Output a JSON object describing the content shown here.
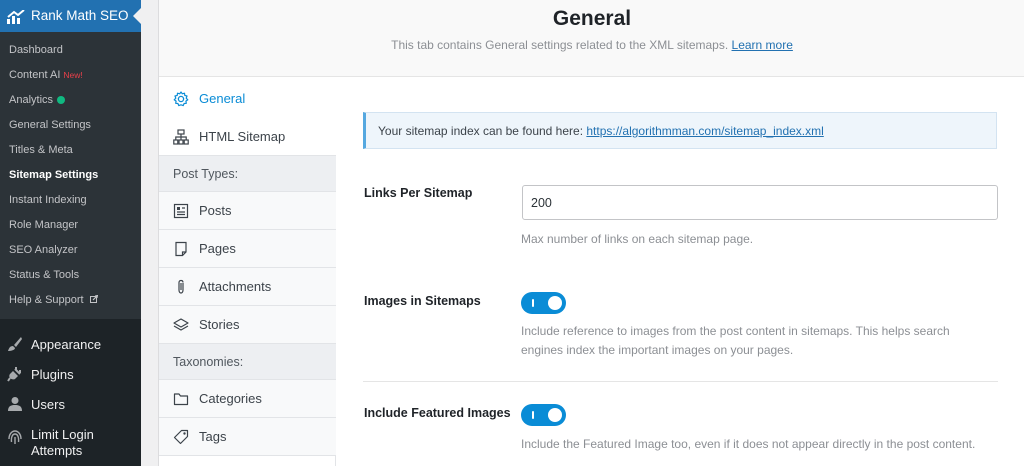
{
  "sidebar": {
    "plugin_title": "Rank Math SEO",
    "submenu": [
      {
        "label": "Dashboard"
      },
      {
        "label": "Content AI",
        "badge": "New!"
      },
      {
        "label": "Analytics",
        "status_color": "#10b981"
      },
      {
        "label": "General Settings"
      },
      {
        "label": "Titles & Meta"
      },
      {
        "label": "Sitemap Settings",
        "current": true
      },
      {
        "label": "Instant Indexing"
      },
      {
        "label": "Role Manager"
      },
      {
        "label": "SEO Analyzer"
      },
      {
        "label": "Status & Tools"
      },
      {
        "label": "Help & Support",
        "icon": "external-link-icon"
      }
    ],
    "main_menu": [
      {
        "label": "Appearance",
        "icon": "paintbrush-icon"
      },
      {
        "label": "Plugins",
        "icon": "plug-icon"
      },
      {
        "label": "Users",
        "icon": "user-icon"
      },
      {
        "label": "Limit Login Attempts",
        "label_line1": "Limit Login",
        "label_line2": "Attempts",
        "icon": "fingerprint-icon"
      }
    ]
  },
  "header": {
    "title": "General",
    "description": "This tab contains General settings related to the XML sitemaps.",
    "learn_more": "Learn more"
  },
  "tabs": {
    "general": {
      "label": "General",
      "icon": "gear-icon",
      "active": true
    },
    "html_sitemap": {
      "label": "HTML Sitemap",
      "icon": "sitemap-icon"
    },
    "post_types_heading": "Post Types:",
    "posts": {
      "label": "Posts",
      "icon": "posts-icon"
    },
    "pages": {
      "label": "Pages",
      "icon": "pages-icon"
    },
    "attachments": {
      "label": "Attachments",
      "icon": "paperclip-icon"
    },
    "stories": {
      "label": "Stories",
      "icon": "stories-icon"
    },
    "taxonomies_heading": "Taxonomies:",
    "categories": {
      "label": "Categories",
      "icon": "folder-icon"
    },
    "tags": {
      "label": "Tags",
      "icon": "tag-icon"
    }
  },
  "settings": {
    "notice_text": "Your sitemap index can be found here:",
    "notice_link": "https://algorithmman.com/sitemap_index.xml",
    "links_per_sitemap": {
      "label": "Links Per Sitemap",
      "value": "200",
      "help": "Max number of links on each sitemap page."
    },
    "images_in_sitemaps": {
      "label": "Images in Sitemaps",
      "enabled": true,
      "help": "Include reference to images from the post content in sitemaps. This helps search engines index the important images on your pages."
    },
    "include_featured_images": {
      "label": "Include Featured Images",
      "enabled": true,
      "help": "Include the Featured Image too, even if it does not appear directly in the post content."
    }
  },
  "colors": {
    "accent": "#0a8cd6",
    "wp_admin_blue": "#2271b1",
    "sidebar_bg": "#1d2327",
    "submenu_bg": "#2c3338"
  }
}
